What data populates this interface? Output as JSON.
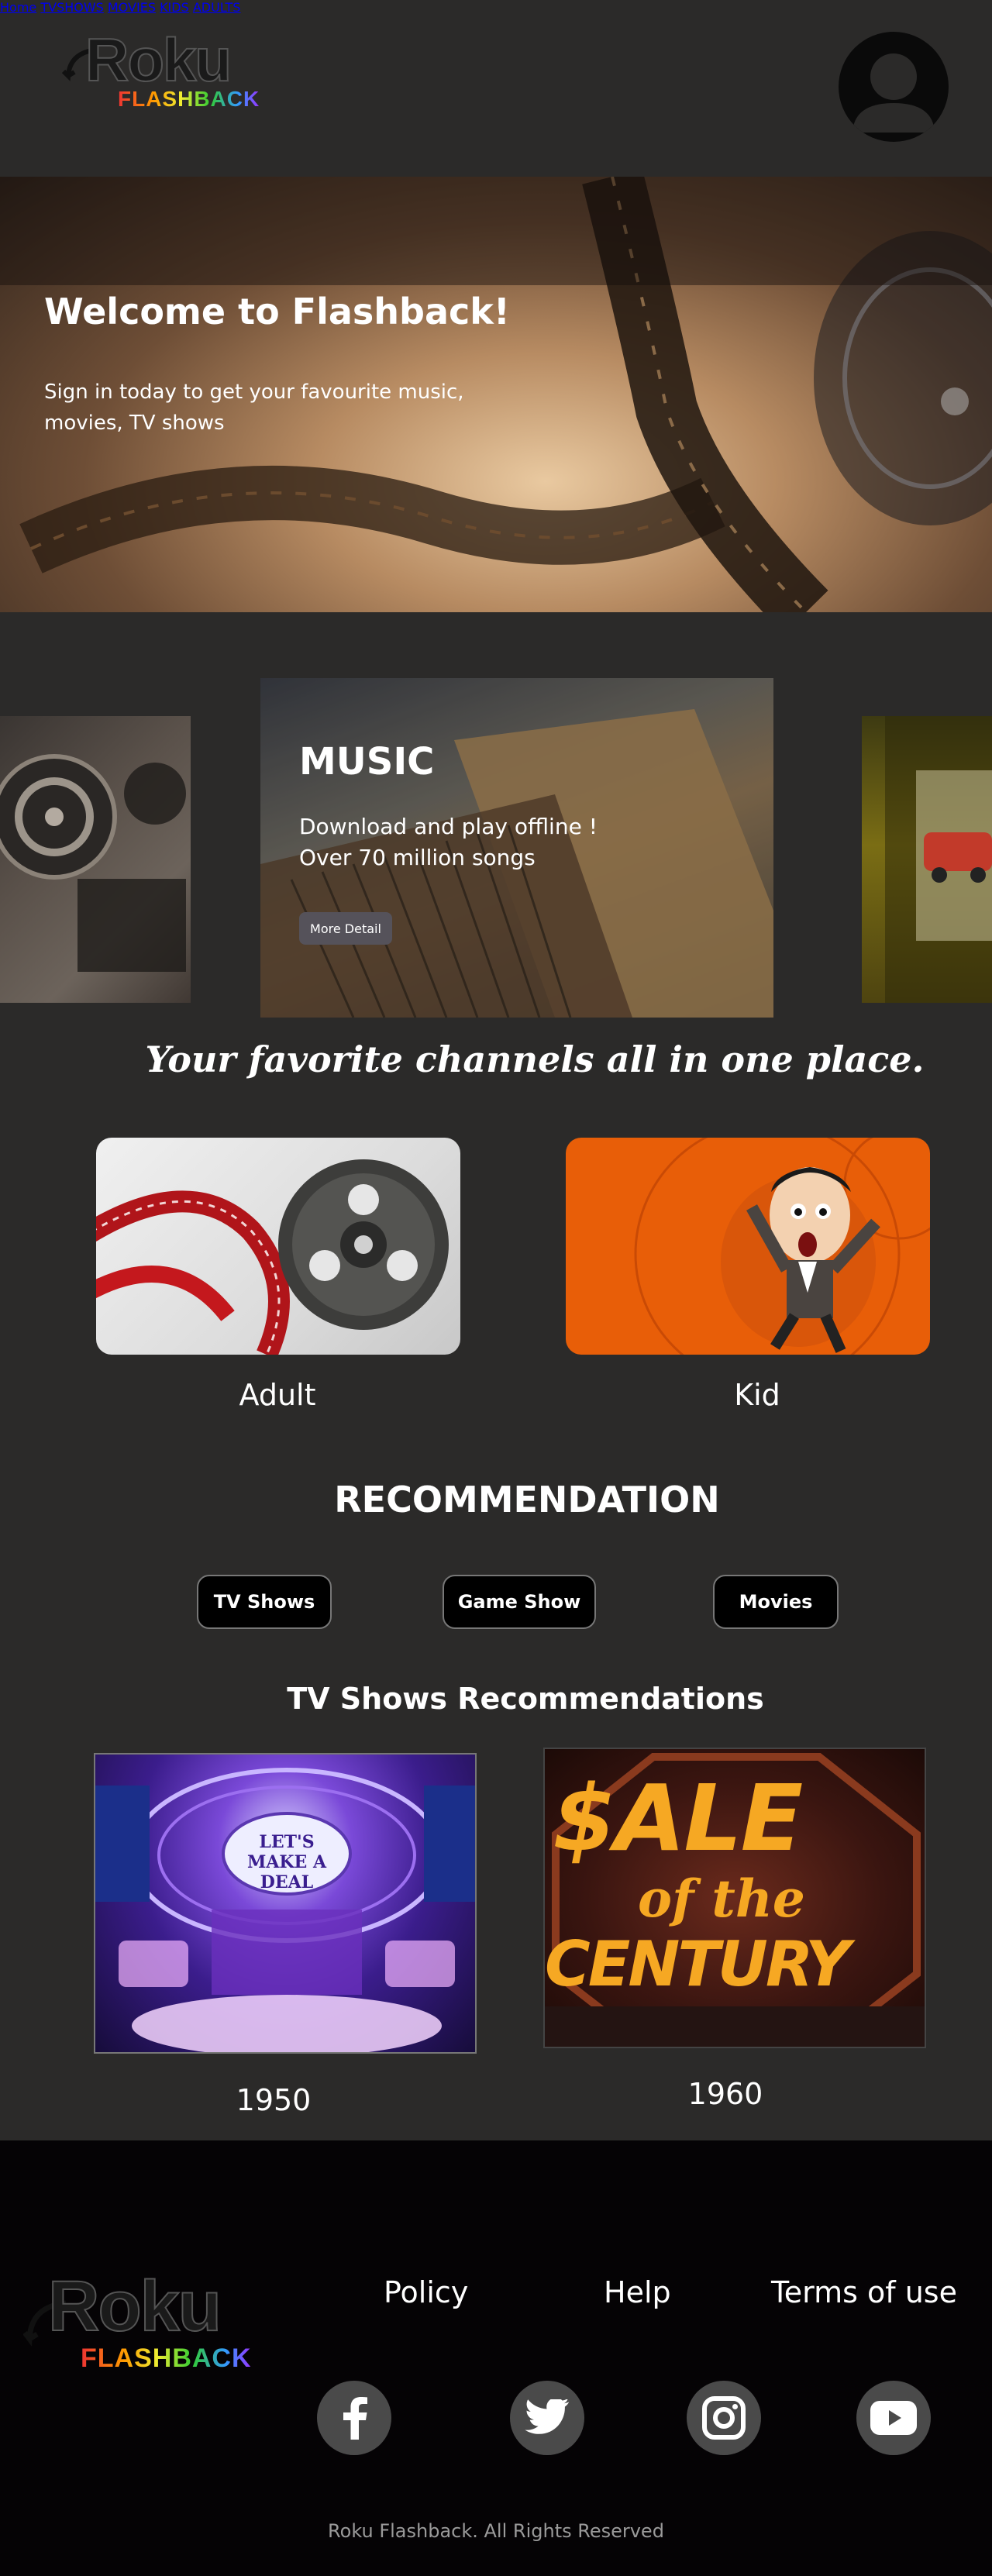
{
  "header": {
    "logo_main": "Roku",
    "logo_sub": "FLASHBACK",
    "nav": [
      {
        "label": "Home"
      },
      {
        "label": "TVSHOWS"
      },
      {
        "label": "MOVIES"
      },
      {
        "label": "KIDS"
      },
      {
        "label": "ADULTS"
      }
    ],
    "avatar_icon": "user-avatar-icon"
  },
  "hero": {
    "title": "Welcome to Flashback!",
    "subtitle": "Sign in today to get your favourite music, movies, TV shows"
  },
  "carousel": {
    "title": "MUSIC",
    "line1": "Download and play offline !",
    "line2": "Over 70 million songs",
    "button": "More Detail"
  },
  "tagline": "Your favorite channels all in one place.",
  "categories": [
    {
      "label": "Adult"
    },
    {
      "label": "Kid"
    }
  ],
  "recommendation": {
    "heading": "RECOMMENDATION",
    "tabs": [
      {
        "label": "TV Shows"
      },
      {
        "label": "Game Show"
      },
      {
        "label": "Movies"
      }
    ],
    "subheading": "TV Shows Recommendations",
    "shows": [
      {
        "poster_text": "LET'S MAKE A DEAL",
        "year": "1950"
      },
      {
        "poster_text_line1": "$ALE",
        "poster_text_line2": "of the",
        "poster_text_line3": "CENTURY",
        "year": "1960"
      }
    ]
  },
  "footer": {
    "logo_main": "Roku",
    "logo_sub": "FLASHBACK",
    "links": [
      {
        "label": "Policy"
      },
      {
        "label": "Help"
      },
      {
        "label": "Terms of use"
      }
    ],
    "social": [
      "facebook-icon",
      "twitter-icon",
      "instagram-icon",
      "youtube-icon"
    ],
    "copyright": "Roku Flashback. All Rights Reserved"
  },
  "colors": {
    "background": "#2b2a29",
    "footer": "#050305",
    "kid_card": "#e85e08"
  }
}
